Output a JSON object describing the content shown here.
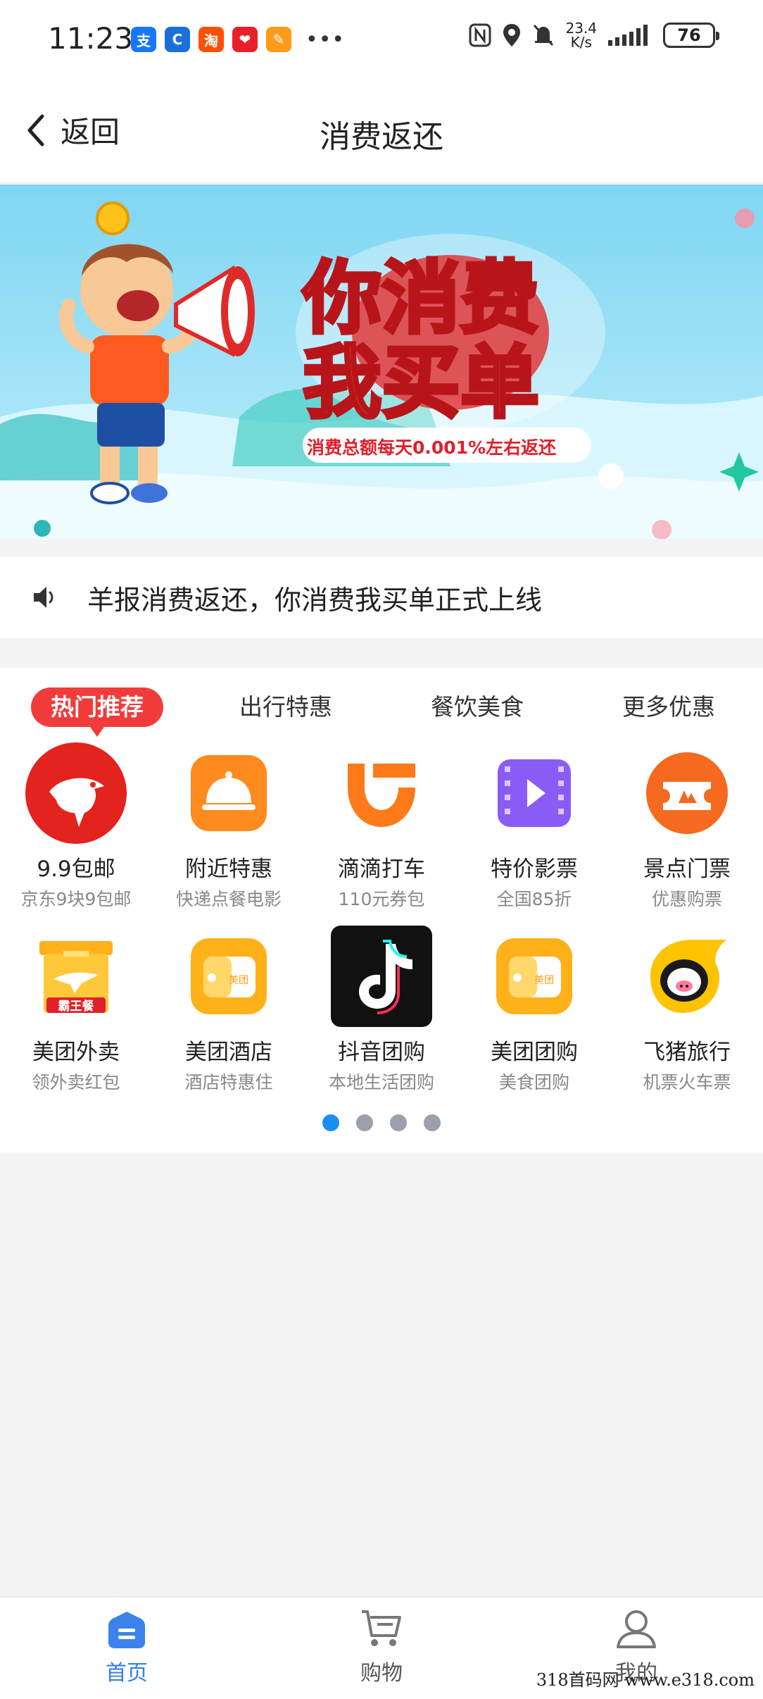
{
  "status_bar": {
    "time": "11:23",
    "speed_value": "23.4",
    "speed_unit": "K/s",
    "battery": "76",
    "apps": [
      {
        "glyph": "支",
        "color": "#1677ff"
      },
      {
        "glyph": "C",
        "color": "#1a6fd9"
      },
      {
        "glyph": "淘",
        "color": "#ff4f00"
      },
      {
        "glyph": "❤",
        "color": "#e8202a"
      },
      {
        "glyph": "✎",
        "color": "#ff9a1a"
      }
    ]
  },
  "header": {
    "back_label": "返回",
    "title": "消费返还"
  },
  "banner": {
    "headline_line1": "你消费",
    "headline_line2": "我买单",
    "subtext": "消费总额每天0.001%左右返还"
  },
  "notice": {
    "text": "羊报消费返还，你消费我买单正式上线"
  },
  "tabs": [
    {
      "label": "热门推荐",
      "active": true
    },
    {
      "label": "出行特惠",
      "active": false
    },
    {
      "label": "餐饮美食",
      "active": false
    },
    {
      "label": "更多优惠",
      "active": false
    }
  ],
  "grid_items": [
    {
      "name": "9.9包邮",
      "sub": "京东9块9包邮",
      "icon": "jd-dog-icon"
    },
    {
      "name": "附近特惠",
      "sub": "快递点餐电影",
      "icon": "food-cover-icon"
    },
    {
      "name": "滴滴打车",
      "sub": "110元券包",
      "icon": "didi-icon"
    },
    {
      "name": "特价影票",
      "sub": "全国85折",
      "icon": "film-icon"
    },
    {
      "name": "景点门票",
      "sub": "优惠购票",
      "icon": "ticket-icon"
    },
    {
      "name": "美团外卖",
      "sub": "领外卖红包",
      "icon": "bawangcan-icon"
    },
    {
      "name": "美团酒店",
      "sub": "酒店特惠住",
      "icon": "meituan-wallet-icon"
    },
    {
      "name": "抖音团购",
      "sub": "本地生活团购",
      "icon": "douyin-icon"
    },
    {
      "name": "美团团购",
      "sub": "美食团购",
      "icon": "meituan-wallet-icon"
    },
    {
      "name": "飞猪旅行",
      "sub": "机票火车票",
      "icon": "fliggy-icon"
    }
  ],
  "icon_texts": {
    "bawangcan": "霸王餐",
    "meituan": "美团"
  },
  "pagination": {
    "count": 4,
    "active_index": 0
  },
  "bottom_nav": [
    {
      "label": "首页",
      "icon": "home-icon",
      "active": true
    },
    {
      "label": "购物",
      "icon": "cart-icon",
      "active": false
    },
    {
      "label": "我的",
      "icon": "user-icon",
      "active": false
    }
  ],
  "watermark": "318首码网   www.e318.com",
  "colors": {
    "accent_red": "#f23b3b",
    "accent_blue": "#2f7fe9",
    "dot_active": "#1b8ef2",
    "orange": "#ff8a1e"
  }
}
